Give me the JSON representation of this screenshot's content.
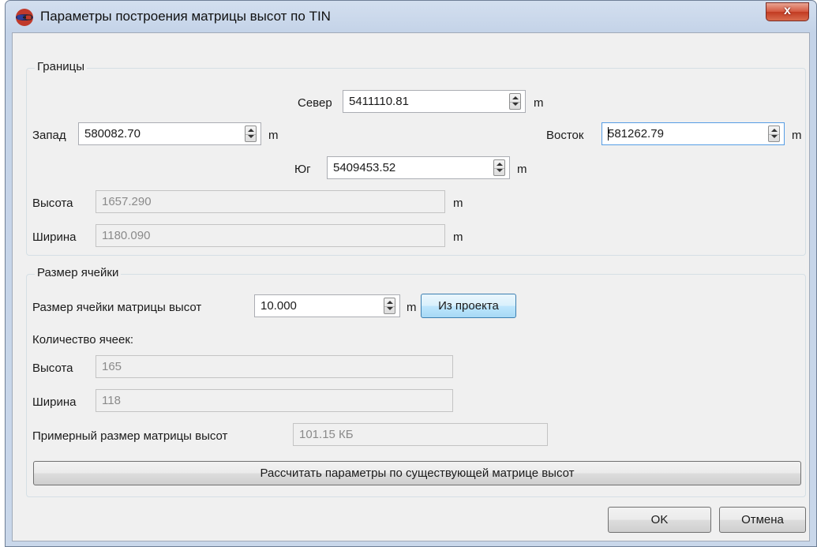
{
  "window": {
    "title": "Параметры построения матрицы высот по TIN",
    "close_glyph": "x",
    "icon": "globe-3d-glasses-icon"
  },
  "bounds": {
    "legend": "Границы",
    "north": {
      "label": "Север",
      "value": "5411110.81",
      "unit": "m"
    },
    "west": {
      "label": "Запад",
      "value": "580082.70",
      "unit": "m"
    },
    "east": {
      "label": "Восток",
      "value": "581262.79",
      "unit": "m"
    },
    "south": {
      "label": "Юг",
      "value": "5409453.52",
      "unit": "m"
    },
    "height": {
      "label": "Высота",
      "value": "1657.290",
      "unit": "m"
    },
    "width": {
      "label": "Ширина",
      "value": "1180.090",
      "unit": "m"
    }
  },
  "cell": {
    "legend": "Размер ячейки",
    "size": {
      "label": "Размер ячейки матрицы высот",
      "value": "10.000",
      "unit": "m"
    },
    "from_project_label": "Из проекта",
    "count_label": "Количество ячеек:",
    "height": {
      "label": "Высота",
      "value": "165"
    },
    "width": {
      "label": "Ширина",
      "value": "118"
    },
    "approx": {
      "label": "Примерный размер матрицы высот",
      "value": "101.15 КБ"
    },
    "calc_label": "Рассчитать параметры по существующей матрице высот"
  },
  "buttons": {
    "ok": "OK",
    "cancel": "Отмена"
  }
}
